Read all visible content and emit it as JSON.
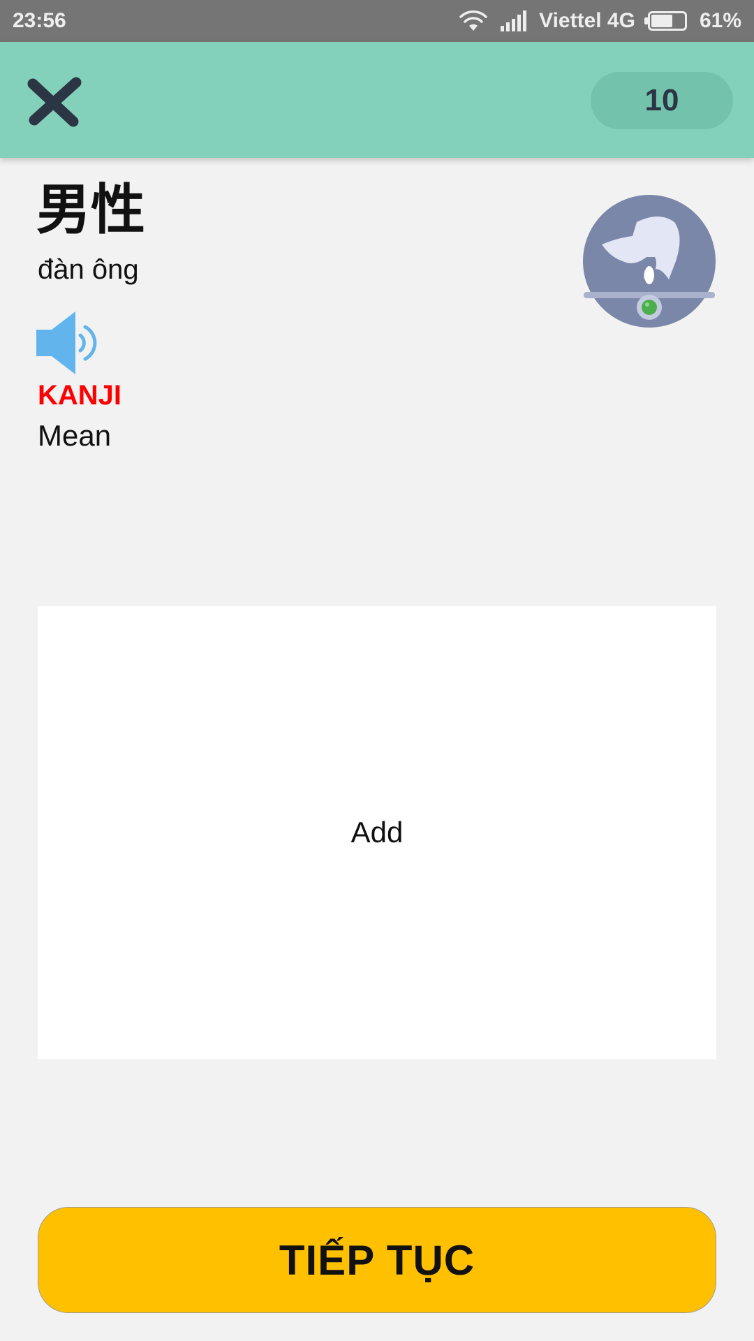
{
  "status_bar": {
    "time": "23:56",
    "carrier": "Viettel 4G",
    "battery": "61%",
    "battery_level": 0.61,
    "icons": [
      "wifi-icon",
      "signal-icon",
      "battery-icon"
    ]
  },
  "header": {
    "close_icon": "close-icon",
    "score": "10",
    "colors": {
      "bar": "#83d1bb",
      "pill": "#73c2ac",
      "icon": "#2b3544"
    }
  },
  "word": {
    "kanji": "男性",
    "meaning": "đàn ông",
    "audio_icon": "speaker-icon",
    "kanji_label": "KANJI",
    "mean_label": "Mean",
    "label_color": "#ff0000"
  },
  "avatar_icon": "hand-ring-icon",
  "card": {
    "label": "Add"
  },
  "continue_button": {
    "label": "TIẾP TỤC",
    "color": "#ffc000"
  }
}
